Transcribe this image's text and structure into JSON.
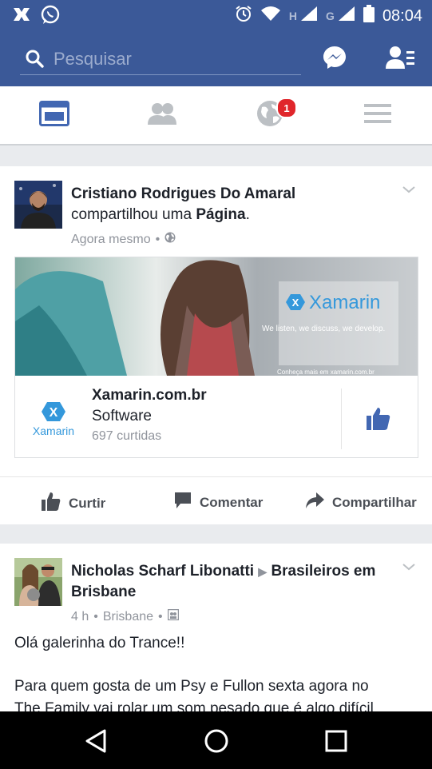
{
  "status_bar": {
    "time": "08:04",
    "net_h": "H",
    "net_g": "G"
  },
  "search": {
    "placeholder": "Pesquisar"
  },
  "tabs": {
    "notifications_badge": "1"
  },
  "post1": {
    "author": "Cristiano Rodrigues Do Amaral",
    "action_text": "compartilhou uma",
    "object": "Página",
    "object_suffix": ".",
    "time": "Agora mesmo",
    "link": {
      "banner_brand": "Xamarin",
      "banner_tagline": "We listen, we discuss, we develop.",
      "banner_footer": "Conheça mais em xamarin.com.br",
      "logo_text": "Xamarin",
      "title": "Xamarin.com.br",
      "category": "Software",
      "likes": "697 curtidas"
    },
    "actions": {
      "like": "Curtir",
      "comment": "Comentar",
      "share": "Compartilhar"
    }
  },
  "post2": {
    "author": "Nicholas Scharf Libonatti",
    "group": "Brasileiros em Brisbane",
    "time": "4 h",
    "location": "Brisbane",
    "text_line1": "Olá galerinha do Trance!!",
    "text_line2": "Para quem gosta de um Psy e Fullon sexta agora no",
    "text_line3": "The Family vai rolar um som pesado que é algo difícil"
  },
  "colors": {
    "brand": "#3b5998",
    "badge": "#e0262b",
    "like_blue": "#4267b2"
  }
}
